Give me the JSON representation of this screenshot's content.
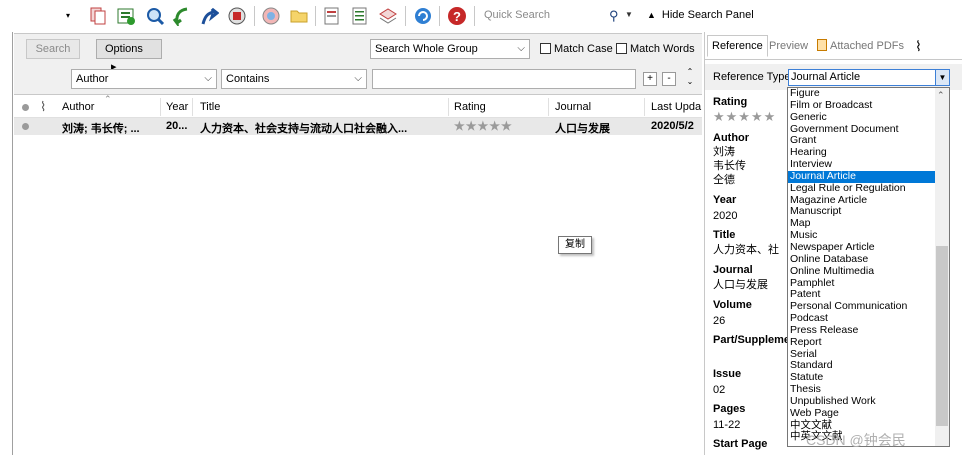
{
  "toolbar": {
    "quick_search_label": "Quick Search",
    "hide_panel_label": "Hide Search Panel",
    "icons": [
      "dropdown-arrow-icon",
      "copy-icon",
      "new-reference-icon",
      "find-fulltext-icon",
      "online-search-icon",
      "share-icon",
      "open-link-icon",
      "word-icon",
      "folder-icon",
      "edit-icon",
      "format-icon",
      "insert-citation-icon",
      "sync-icon",
      "help-icon"
    ]
  },
  "search_panel": {
    "search_button": "Search",
    "options_button": "Options",
    "options_arrow": "▸",
    "scope_select": "Search Whole Group",
    "match_case": "Match Case",
    "match_words": "Match Words",
    "field_select": "Author",
    "condition_select": "Contains",
    "plus": "+",
    "minus": "-"
  },
  "reference_list": {
    "columns": [
      "Author",
      "Year",
      "Title",
      "Rating",
      "Journal",
      "Last Upda"
    ],
    "rows": [
      {
        "author": "刘涛; 韦长传; ...",
        "year": "20...",
        "title": "人力资本、社会支持与流动人口社会融入...",
        "rating": "★★★★★",
        "journal": "人口与发展",
        "last_updated": "2020/5/2"
      }
    ]
  },
  "tooltip": "复制",
  "right_panel": {
    "tabs": [
      "Reference",
      "Preview",
      "Attached PDFs"
    ],
    "reference_type_label": "Reference Type:",
    "reference_type_value": "Journal Article",
    "fields": {
      "rating_label": "Rating",
      "rating_stars": "★★★★★",
      "author_label": "Author",
      "authors": [
        "刘涛",
        "韦长传",
        "仝德"
      ],
      "year_label": "Year",
      "year": "2020",
      "title_label": "Title",
      "title": "人力资本、社",
      "journal_label": "Journal",
      "journal": "人口与发展",
      "volume_label": "Volume",
      "volume": "26",
      "part_label": "Part/Suppleme",
      "issue_label": "Issue",
      "issue": "02",
      "pages_label": "Pages",
      "pages": "11-22",
      "start_page_label": "Start Page"
    }
  },
  "dropdown": {
    "selected": "Journal Article",
    "items": [
      "Figure",
      "Film or Broadcast",
      "Generic",
      "Government Document",
      "Grant",
      "Hearing",
      "Interview",
      "Journal Article",
      "Legal Rule or Regulation",
      "Magazine Article",
      "Manuscript",
      "Map",
      "Music",
      "Newspaper Article",
      "Online Database",
      "Online Multimedia",
      "Pamphlet",
      "Patent",
      "Personal Communication",
      "Podcast",
      "Press Release",
      "Report",
      "Serial",
      "Standard",
      "Statute",
      "Thesis",
      "Unpublished Work",
      "Web Page",
      "中文文献",
      "中英文文献"
    ]
  },
  "watermark": "CSDN @钟会民",
  "colors": {
    "selection": "#0078d7",
    "panel_bg": "#f0f0f0",
    "row_bg": "#e8e8e8"
  }
}
